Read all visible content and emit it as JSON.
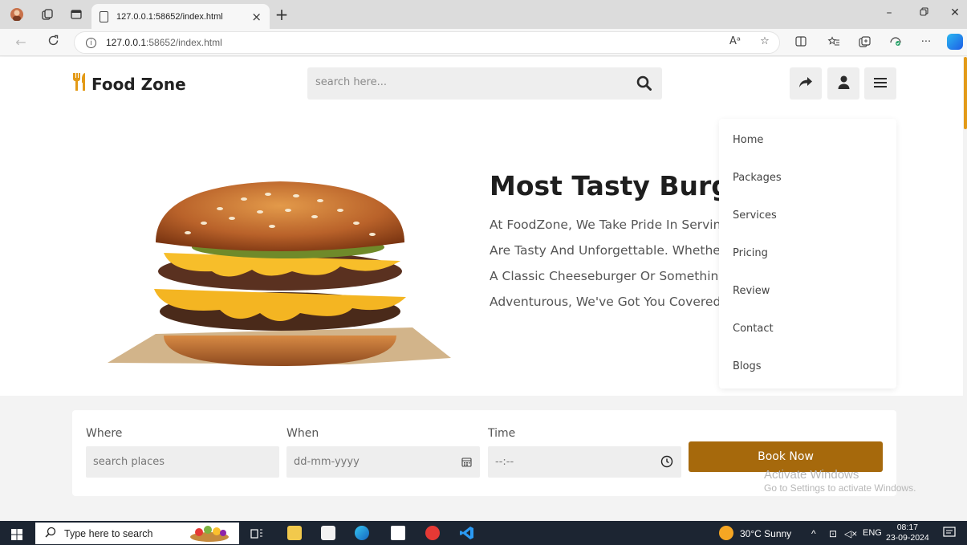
{
  "browser": {
    "tab_title": "127.0.0.1:58652/index.html",
    "tab_close": "×",
    "new_tab": "+",
    "url_host": "127.0.0.1",
    "url_rest": ":58652/index.html",
    "read_aloud": "Aᵃ"
  },
  "header": {
    "logo_text": "Food Zone",
    "search_placeholder": "search here..."
  },
  "hero": {
    "title": "Most Tasty Burger",
    "text": "At FoodZone, We Take Pride In Serving Burgers That Are Tasty And Unforgettable. Whether You're Craving A Classic Cheeseburger Or Something More Adventurous, We've Got You Covered"
  },
  "menu": {
    "items": [
      "Home",
      "Packages",
      "Services",
      "Pricing",
      "Review",
      "Contact",
      "Blogs"
    ]
  },
  "booking": {
    "where_label": "Where",
    "where_placeholder": "search places",
    "when_label": "When",
    "when_placeholder": "dd-mm-yyyy",
    "time_label": "Time",
    "time_placeholder": "--:--",
    "button": "Book Now"
  },
  "watermark": {
    "line1": "Activate Windows",
    "line2": "Go to Settings to activate Windows."
  },
  "taskbar": {
    "search_placeholder": "Type here to search",
    "weather": "30°C  Sunny",
    "lang": "ENG",
    "time": "08:17",
    "date": "23-09-2024"
  },
  "colors": {
    "accent": "#a6690c",
    "logo_icon": "#e39a17"
  }
}
